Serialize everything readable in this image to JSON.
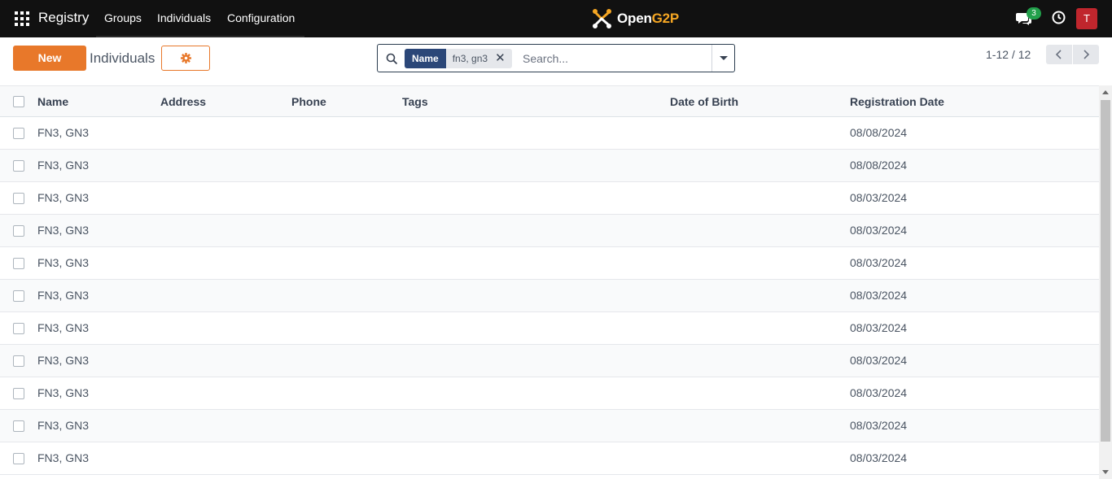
{
  "navbar": {
    "app_name": "Registry",
    "menu": [
      "Groups",
      "Individuals",
      "Configuration"
    ],
    "logo_text_main": "Open",
    "logo_text_accent": "G2P",
    "chat_count": "3",
    "avatar_initial": "T"
  },
  "control_panel": {
    "new_label": "New",
    "title": "Individuals",
    "search": {
      "facet_label": "Name",
      "facet_value": "fn3, gn3",
      "placeholder": "Search..."
    },
    "pager": "1-12 / 12"
  },
  "table": {
    "columns": [
      "Name",
      "Address",
      "Phone",
      "Tags",
      "Date of Birth",
      "Registration Date"
    ],
    "rows": [
      {
        "name": "FN3, GN3",
        "address": "",
        "phone": "",
        "tags": "",
        "dob": "",
        "reg_date": "08/08/2024"
      },
      {
        "name": "FN3, GN3",
        "address": "",
        "phone": "",
        "tags": "",
        "dob": "",
        "reg_date": "08/08/2024"
      },
      {
        "name": "FN3, GN3",
        "address": "",
        "phone": "",
        "tags": "",
        "dob": "",
        "reg_date": "08/03/2024"
      },
      {
        "name": "FN3, GN3",
        "address": "",
        "phone": "",
        "tags": "",
        "dob": "",
        "reg_date": "08/03/2024"
      },
      {
        "name": "FN3, GN3",
        "address": "",
        "phone": "",
        "tags": "",
        "dob": "",
        "reg_date": "08/03/2024"
      },
      {
        "name": "FN3, GN3",
        "address": "",
        "phone": "",
        "tags": "",
        "dob": "",
        "reg_date": "08/03/2024"
      },
      {
        "name": "FN3, GN3",
        "address": "",
        "phone": "",
        "tags": "",
        "dob": "",
        "reg_date": "08/03/2024"
      },
      {
        "name": "FN3, GN3",
        "address": "",
        "phone": "",
        "tags": "",
        "dob": "",
        "reg_date": "08/03/2024"
      },
      {
        "name": "FN3, GN3",
        "address": "",
        "phone": "",
        "tags": "",
        "dob": "",
        "reg_date": "08/03/2024"
      },
      {
        "name": "FN3, GN3",
        "address": "",
        "phone": "",
        "tags": "",
        "dob": "",
        "reg_date": "08/03/2024"
      },
      {
        "name": "FN3, GN3",
        "address": "",
        "phone": "",
        "tags": "",
        "dob": "",
        "reg_date": "08/03/2024"
      }
    ]
  },
  "colors": {
    "navbar_bg": "#111111",
    "accent_orange": "#e8782a",
    "facet_blue": "#2b4778",
    "badge_green": "#22a04b",
    "avatar_red": "#c0262d"
  },
  "icons": [
    "apps-grid-icon",
    "openg2p-logo-icon",
    "chat-icon",
    "clock-icon",
    "gear-icon",
    "search-icon",
    "close-icon",
    "caret-down-icon",
    "chevron-left-icon",
    "chevron-right-icon"
  ]
}
